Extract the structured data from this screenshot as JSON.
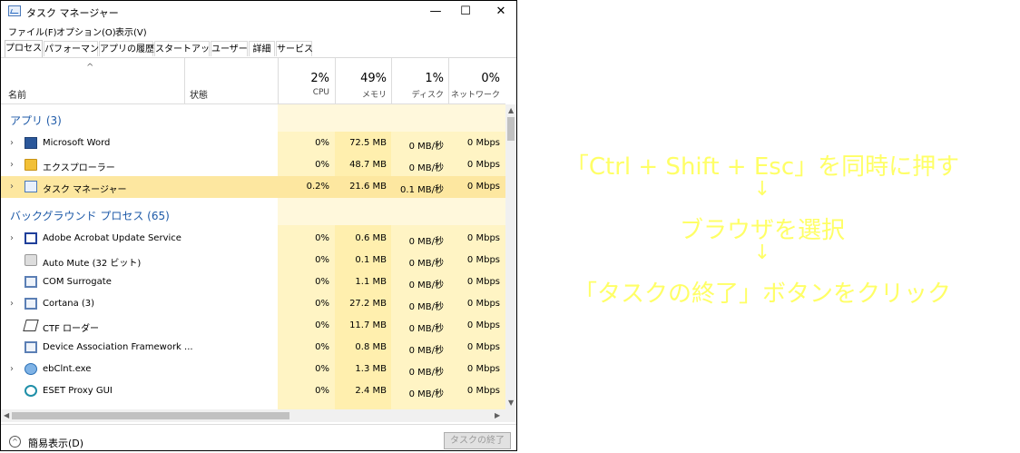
{
  "window": {
    "title": "タスク マネージャー",
    "min": "—",
    "max": "☐",
    "close": "✕"
  },
  "menu": [
    "ファイル(F)",
    "オプション(O)",
    "表示(V)"
  ],
  "tabs": [
    "プロセス",
    "パフォーマンス",
    "アプリの履歴",
    "スタートアップ",
    "ユーザー",
    "詳細",
    "サービス"
  ],
  "header": {
    "name": "名前",
    "status": "状態",
    "cpu_pct": "2%",
    "cpu": "CPU",
    "mem_pct": "49%",
    "mem": "メモリ",
    "disk_pct": "1%",
    "disk": "ディスク",
    "net_pct": "0%",
    "net": "ネットワーク"
  },
  "groups": {
    "apps": "アプリ (3)",
    "background": "バックグラウンド プロセス (65)"
  },
  "apps": [
    {
      "name": "Microsoft Word",
      "cpu": "0%",
      "mem": "72.5 MB",
      "disk": "0 MB/秒",
      "net": "0 Mbps",
      "icon": "word-icon"
    },
    {
      "name": "エクスプローラー",
      "cpu": "0%",
      "mem": "48.7 MB",
      "disk": "0 MB/秒",
      "net": "0 Mbps",
      "icon": "folder-icon"
    },
    {
      "name": "タスク マネージャー",
      "cpu": "0.2%",
      "mem": "21.6 MB",
      "disk": "0.1 MB/秒",
      "net": "0 Mbps",
      "icon": "taskmanager-icon"
    }
  ],
  "background": [
    {
      "name": "Adobe Acrobat Update Service",
      "cpu": "0%",
      "mem": "0.6 MB",
      "disk": "0 MB/秒",
      "net": "0 Mbps",
      "icon": "service-window-icon",
      "chevron": true
    },
    {
      "name": "Auto Mute (32 ビット)",
      "cpu": "0%",
      "mem": "0.1 MB",
      "disk": "0 MB/秒",
      "net": "0 Mbps",
      "icon": "speaker-muted-icon",
      "chevron": false
    },
    {
      "name": "COM Surrogate",
      "cpu": "0%",
      "mem": "1.1 MB",
      "disk": "0 MB/秒",
      "net": "0 Mbps",
      "icon": "service-window-icon",
      "chevron": false
    },
    {
      "name": "Cortana (3)",
      "cpu": "0%",
      "mem": "27.2 MB",
      "disk": "0 MB/秒",
      "net": "0 Mbps",
      "icon": "service-window-icon",
      "chevron": true
    },
    {
      "name": "CTF ローダー",
      "cpu": "0%",
      "mem": "11.7 MB",
      "disk": "0 MB/秒",
      "net": "0 Mbps",
      "icon": "pen-icon",
      "chevron": false
    },
    {
      "name": "Device Association Framework ...",
      "cpu": "0%",
      "mem": "0.8 MB",
      "disk": "0 MB/秒",
      "net": "0 Mbps",
      "icon": "service-window-icon",
      "chevron": false
    },
    {
      "name": "ebClnt.exe",
      "cpu": "0%",
      "mem": "1.3 MB",
      "disk": "0 MB/秒",
      "net": "0 Mbps",
      "icon": "globe-icon",
      "chevron": true
    },
    {
      "name": "ESET Proxy GUI",
      "cpu": "0%",
      "mem": "2.4 MB",
      "disk": "0 MB/秒",
      "net": "0 Mbps",
      "icon": "eset-icon",
      "chevron": false
    }
  ],
  "footer": {
    "fewer_details": "簡易表示(D)",
    "end_task": "タスクの終了(E)"
  },
  "instructions": {
    "line1": "「Ctrl + Shift + Esc」を同時に押す",
    "arrow1": "↓",
    "line2": "ブラウザを選択",
    "arrow2": "↓",
    "line3": "「タスクの終了」ボタンをクリック"
  },
  "colors": {
    "accent": "#1e5aa8",
    "cpu_bg": "#fff4c4",
    "mem_bg": "#ffefae",
    "instruction": "#ffff66"
  }
}
